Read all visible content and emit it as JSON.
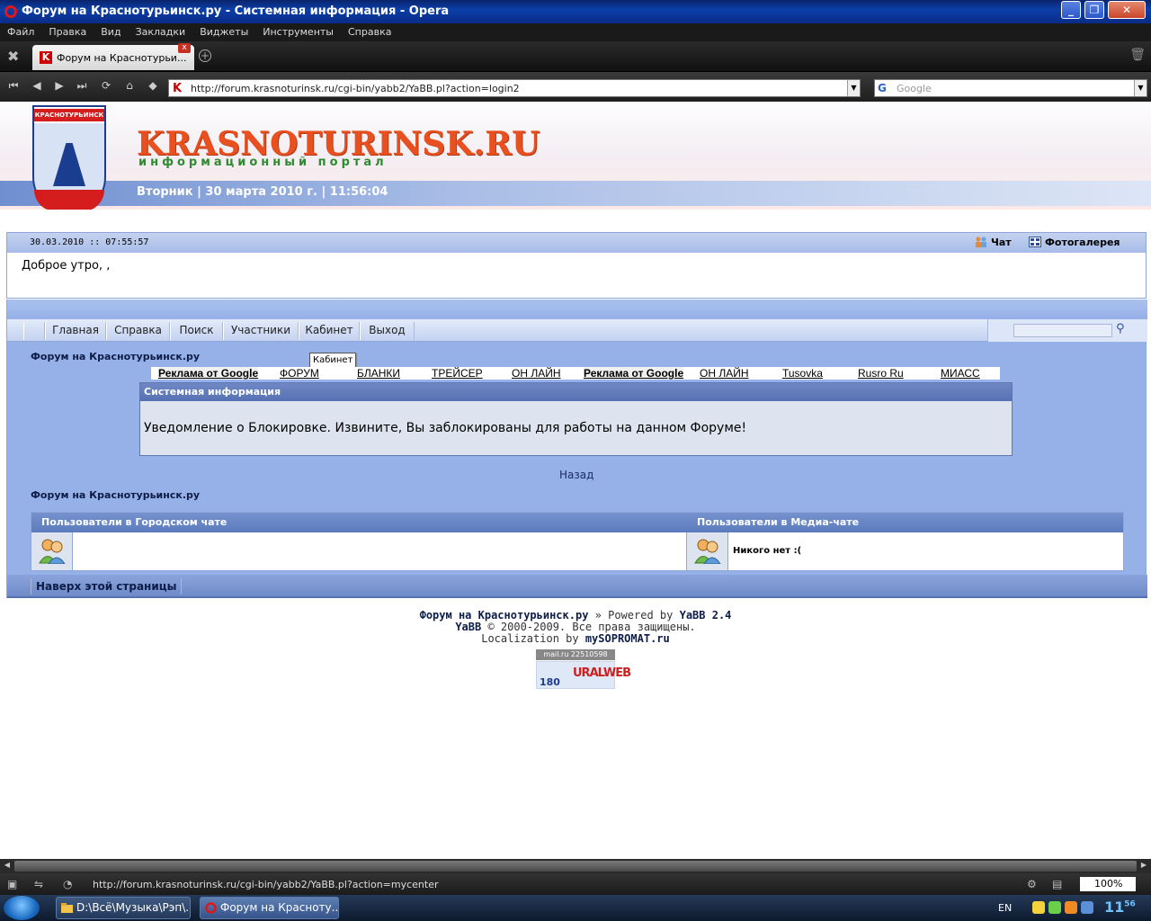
{
  "window": {
    "title": "Форум на Краснотурьинск.ру - Системная информация - Opera"
  },
  "menu": [
    "Файл",
    "Правка",
    "Вид",
    "Закладки",
    "Виджеты",
    "Инструменты",
    "Справка"
  ],
  "tab": {
    "label": "Форум на Краснотурьи...",
    "favicon": "K"
  },
  "address": {
    "url": "http://forum.krasnoturinsk.ru/cgi-bin/yabb2/YaBB.pl?action=login2",
    "favicon": "K"
  },
  "search": {
    "placeholder": "Google"
  },
  "banner": {
    "crest_ribbon": "КРАСНОТУРЬИНСК",
    "brand": "KRASNOTURINSK.RU",
    "brand_sub": "информационный портал",
    "date": "Вторник | 30 марта 2010 г. | 11:56:04"
  },
  "welcome": {
    "timestamp": "30.03.2010 :: 07:55:57",
    "chat": "Чат",
    "gallery": "Фотогалерея",
    "greeting": "Доброе утро, ,"
  },
  "nav": [
    "Главная",
    "Справка",
    "Поиск",
    "Участники",
    "Кабинет",
    "Выход"
  ],
  "forum_title": "Форум на Краснотурьинск.ру",
  "tooltip": "Кабинет",
  "adbar": {
    "left": [
      "Реклама от Google",
      "ФОРУМ",
      "БЛАНКИ",
      "ТРЕЙСЕР",
      "ОН ЛАЙН"
    ],
    "right": [
      "Реклама от Google",
      "ОН ЛАЙН",
      "Tusovka",
      "Rusro Ru",
      "МИАСС"
    ]
  },
  "system": {
    "header": "Системная информация",
    "message": "Уведомление о Блокировке. Извините, Вы заблокированы для работы на данном Форуме!"
  },
  "back": "Назад",
  "users": {
    "city_chat": "Пользователи в Городском чате",
    "media_chat": "Пользователи в Медиа-чате",
    "nobody": "Никого нет :("
  },
  "to_top": "Наверх этой страницы",
  "footer": {
    "line1_site": "Форум на Краснотурьинск.ру",
    "line1_sep": " » Powered by ",
    "line1_engine": "YaBB 2.4",
    "line2_brand": "YaBB",
    "line2_text": " © 2000-2009. Все права защищены.",
    "line3_text": "Localization by ",
    "line3_brand": "mySOPROMAT.ru",
    "counter1": "mail.ru 22510598",
    "counter2_num": "180",
    "counter2_brand": "URALWEB"
  },
  "status": {
    "url": "http://forum.krasnoturinsk.ru/cgi-bin/yabb2/YaBB.pl?action=mycenter",
    "zoom": "100%"
  },
  "taskbar": {
    "tasks": [
      "D:\\Всё\\Музыка\\Рэп\\...",
      "Форум на Красноту..."
    ],
    "lang": "EN",
    "clock_hour": "11",
    "clock_min": "56"
  }
}
